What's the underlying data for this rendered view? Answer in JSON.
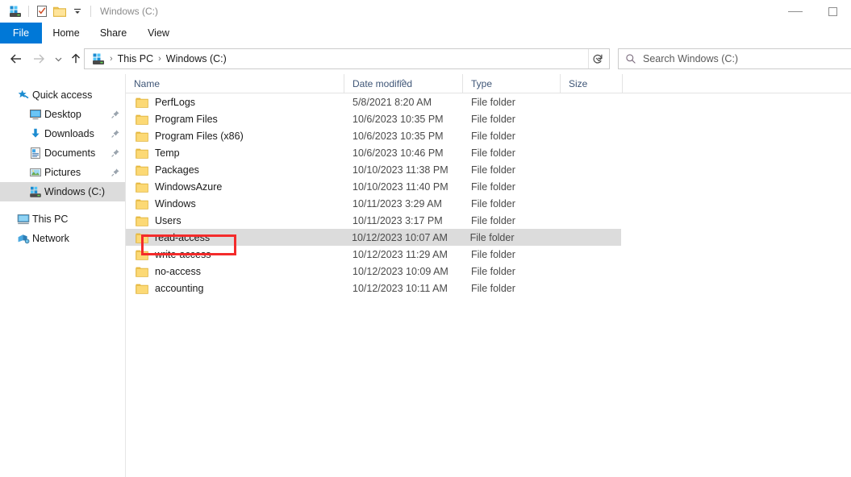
{
  "window": {
    "title": "Windows (C:)",
    "quick_access_toolbar": [
      {
        "name": "drive-icon",
        "label": "Windows (C:) drive"
      },
      {
        "name": "properties-icon",
        "label": "Properties"
      },
      {
        "name": "new-folder-icon",
        "label": "New folder"
      },
      {
        "name": "customize-chevron-icon",
        "label": "Customize Quick Access Toolbar"
      }
    ],
    "controls": {
      "minimize": "Minimize",
      "maximize": "Maximize"
    }
  },
  "ribbon": {
    "tabs": [
      {
        "label": "File",
        "active": true
      },
      {
        "label": "Home",
        "active": false
      },
      {
        "label": "Share",
        "active": false
      },
      {
        "label": "View",
        "active": false
      }
    ]
  },
  "navigation": {
    "back": "Back",
    "forward": "Forward",
    "recent": "Recent locations",
    "up": "Up",
    "refresh": "Refresh",
    "address_dropdown": "Previous locations",
    "breadcrumb": [
      {
        "label": "This PC"
      },
      {
        "label": "Windows (C:)"
      }
    ],
    "breadcrumb_separator": "›"
  },
  "search": {
    "placeholder": "Search Windows (C:)",
    "value": "",
    "icon": "search-icon"
  },
  "sidebar": {
    "items": [
      {
        "label": "Quick access",
        "icon": "star-pin-icon",
        "level": 0,
        "pinned": false,
        "selected": false
      },
      {
        "label": "Desktop",
        "icon": "desktop-icon",
        "level": 1,
        "pinned": true,
        "selected": false
      },
      {
        "label": "Downloads",
        "icon": "downloads-icon",
        "level": 1,
        "pinned": true,
        "selected": false
      },
      {
        "label": "Documents",
        "icon": "documents-icon",
        "level": 1,
        "pinned": true,
        "selected": false
      },
      {
        "label": "Pictures",
        "icon": "pictures-icon",
        "level": 1,
        "pinned": true,
        "selected": false
      },
      {
        "label": "Windows (C:)",
        "icon": "drive-icon",
        "level": 1,
        "pinned": false,
        "selected": true
      },
      {
        "label": "This PC",
        "icon": "this-pc-icon",
        "level": 0,
        "pinned": false,
        "selected": false
      },
      {
        "label": "Network",
        "icon": "network-icon",
        "level": 0,
        "pinned": false,
        "selected": false
      }
    ]
  },
  "file_list": {
    "columns": [
      {
        "label": "Name",
        "sorted": false
      },
      {
        "label": "Date modified",
        "sorted": true,
        "sort_direction": "ascending"
      },
      {
        "label": "Type",
        "sorted": false
      },
      {
        "label": "Size",
        "sorted": false
      }
    ],
    "rows": [
      {
        "name": "PerfLogs",
        "date": "5/8/2021 8:20 AM",
        "type": "File folder",
        "size": "",
        "selected": false,
        "highlighted": false
      },
      {
        "name": "Program Files",
        "date": "10/6/2023 10:35 PM",
        "type": "File folder",
        "size": "",
        "selected": false,
        "highlighted": false
      },
      {
        "name": "Program Files (x86)",
        "date": "10/6/2023 10:35 PM",
        "type": "File folder",
        "size": "",
        "selected": false,
        "highlighted": false
      },
      {
        "name": "Temp",
        "date": "10/6/2023 10:46 PM",
        "type": "File folder",
        "size": "",
        "selected": false,
        "highlighted": false
      },
      {
        "name": "Packages",
        "date": "10/10/2023 11:38 PM",
        "type": "File folder",
        "size": "",
        "selected": false,
        "highlighted": false
      },
      {
        "name": "WindowsAzure",
        "date": "10/10/2023 11:40 PM",
        "type": "File folder",
        "size": "",
        "selected": false,
        "highlighted": false
      },
      {
        "name": "Windows",
        "date": "10/11/2023 3:29 AM",
        "type": "File folder",
        "size": "",
        "selected": false,
        "highlighted": false
      },
      {
        "name": "Users",
        "date": "10/11/2023 3:17 PM",
        "type": "File folder",
        "size": "",
        "selected": false,
        "highlighted": false
      },
      {
        "name": "read-access",
        "date": "10/12/2023 10:07 AM",
        "type": "File folder",
        "size": "",
        "selected": true,
        "highlighted": true
      },
      {
        "name": "write-access",
        "date": "10/12/2023 11:29 AM",
        "type": "File folder",
        "size": "",
        "selected": false,
        "highlighted": false
      },
      {
        "name": "no-access",
        "date": "10/12/2023 10:09 AM",
        "type": "File folder",
        "size": "",
        "selected": false,
        "highlighted": false
      },
      {
        "name": "accounting",
        "date": "10/12/2023 10:11 AM",
        "type": "File folder",
        "size": "",
        "selected": false,
        "highlighted": false
      }
    ]
  },
  "annotation": {
    "target": "read-access",
    "color": "#f42b2b"
  },
  "colors": {
    "accent": "#0078d7",
    "selection": "#dcdcdc",
    "folder": "#fcd975",
    "header_text": "#3f5677",
    "annotation": "#f42b2b"
  }
}
